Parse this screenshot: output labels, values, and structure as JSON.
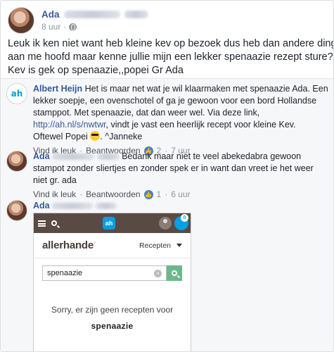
{
  "post": {
    "author": "Ada",
    "time": "8 uur",
    "lines": [
      "Leuk ik ken niet want heb kleine kev op bezoek dus heb dan andere dinge",
      "aan me hoofd maar kenne jullie mijn een lekker spenaazie rezept sture??!",
      "Kev is gek op spenaazie,,popei Gr Ada"
    ]
  },
  "comments": [
    {
      "author": "Albert Heijn",
      "lines": [
        "Het is maar net wat je wil klaarmaken met spenaazie Ada. Een",
        "lekker soepje, een ovenschotel of ga je gewoon voor een bord Hollandse",
        "stamppot. Met spenaazie, dat dan weer wel. Via deze link,"
      ],
      "link": "http://ah.nl/s/nwtwr",
      "after_link": ", vindt je vast een heerlijk recept voor kleine Kev.",
      "sign_before": "Oftewel Popei",
      "sign_after": ". ^Janneke",
      "like": "Vind ik leuk",
      "reply": "Beantwoorden",
      "likes": "2",
      "time": "7 uur"
    },
    {
      "author": "Ada",
      "first": "Bedank maar niet te veel abekedabra gewoon",
      "lines": [
        "stampot zonder sliertjes en zonder spek er in want dan vreet ie het weer",
        "niet gr. ada"
      ],
      "like": "Vind ik leuk",
      "reply": "Beantwoorden",
      "likes": "1",
      "time": "6 uur"
    },
    {
      "author": "Ada"
    }
  ],
  "screenshot": {
    "ah_logo": "ah",
    "basket_count": "0",
    "brand": "allerhande",
    "menu": "Recepten",
    "search_value": "spenaazie",
    "sorry": "Sorry, er zijn geen recepten voor",
    "term": "spenaazie"
  },
  "icons": [
    "globe-icon",
    "like-icon",
    "emoji-sunglasses-icon",
    "menu-icon",
    "search-icon",
    "user-icon",
    "basket-icon",
    "clear-icon",
    "caret-down-icon"
  ],
  "colors": {
    "link": "#365899",
    "ah_blue": "#00a0e2",
    "bar_brown": "#5a4a44",
    "search_green": "#6bb98a"
  }
}
